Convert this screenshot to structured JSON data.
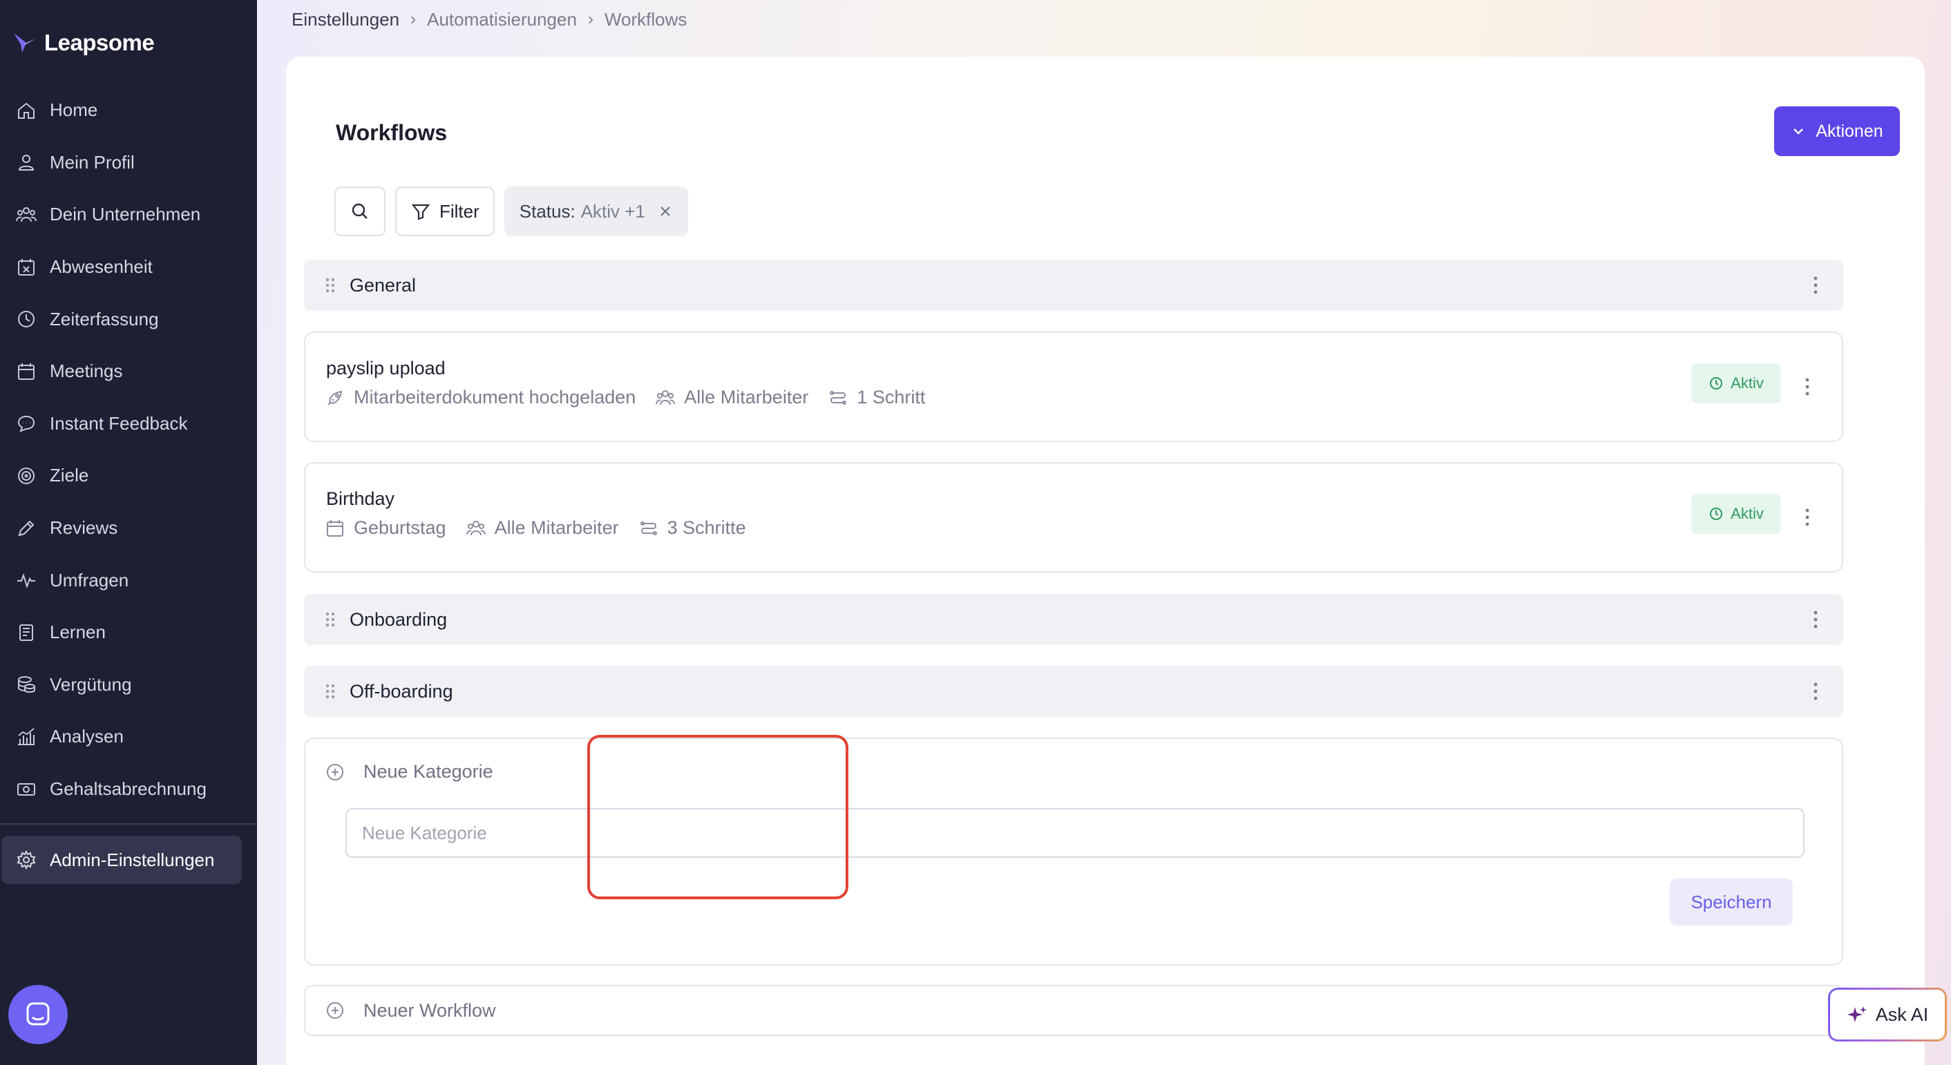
{
  "brand": {
    "name": "Leapsome"
  },
  "sidebar": {
    "items": [
      {
        "label": "Home",
        "icon": "home-icon"
      },
      {
        "label": "Mein Profil",
        "icon": "user-icon"
      },
      {
        "label": "Dein Unternehmen",
        "icon": "people-icon"
      },
      {
        "label": "Abwesenheit",
        "icon": "calendar-x-icon"
      },
      {
        "label": "Zeiterfassung",
        "icon": "clock-icon"
      },
      {
        "label": "Meetings",
        "icon": "calendar-icon"
      },
      {
        "label": "Instant Feedback",
        "icon": "chat-icon"
      },
      {
        "label": "Ziele",
        "icon": "target-icon"
      },
      {
        "label": "Reviews",
        "icon": "pencil-icon"
      },
      {
        "label": "Umfragen",
        "icon": "pulse-icon"
      },
      {
        "label": "Lernen",
        "icon": "book-icon"
      },
      {
        "label": "Vergütung",
        "icon": "coins-icon"
      },
      {
        "label": "Analysen",
        "icon": "chart-icon"
      },
      {
        "label": "Gehaltsabrechnung",
        "icon": "money-icon"
      }
    ],
    "admin": {
      "label": "Admin-Einstellungen",
      "icon": "gear-icon"
    }
  },
  "breadcrumb": [
    "Einstellungen",
    "Automatisierungen",
    "Workflows"
  ],
  "page": {
    "title": "Workflows",
    "actions_label": "Aktionen"
  },
  "toolbar": {
    "filter_label": "Filter",
    "status_key": "Status:",
    "status_value": "Aktiv +1"
  },
  "categories": {
    "general": "General",
    "onboarding": "Onboarding",
    "offboarding": "Off-boarding"
  },
  "workflows": [
    {
      "title": "payslip upload",
      "trigger": "Mitarbeiterdokument hochgeladen",
      "audience": "Alle Mitarbeiter",
      "steps": "1 Schritt",
      "status": "Aktiv"
    },
    {
      "title": "Birthday",
      "trigger": "Geburtstag",
      "audience": "Alle Mitarbeiter",
      "steps": "3 Schritte",
      "status": "Aktiv"
    }
  ],
  "new_category": {
    "heading": "Neue Kategorie",
    "placeholder": "Neue Kategorie",
    "save_label": "Speichern"
  },
  "new_workflow": {
    "label": "Neuer Workflow"
  },
  "ask_ai": {
    "label": "Ask AI"
  },
  "colors": {
    "sidebar_bg": "#1e1f33",
    "accent": "#5b45e9",
    "active_badge_bg": "#e5f6ec",
    "active_badge_text": "#2f9a5f",
    "highlight": "#e34234"
  }
}
